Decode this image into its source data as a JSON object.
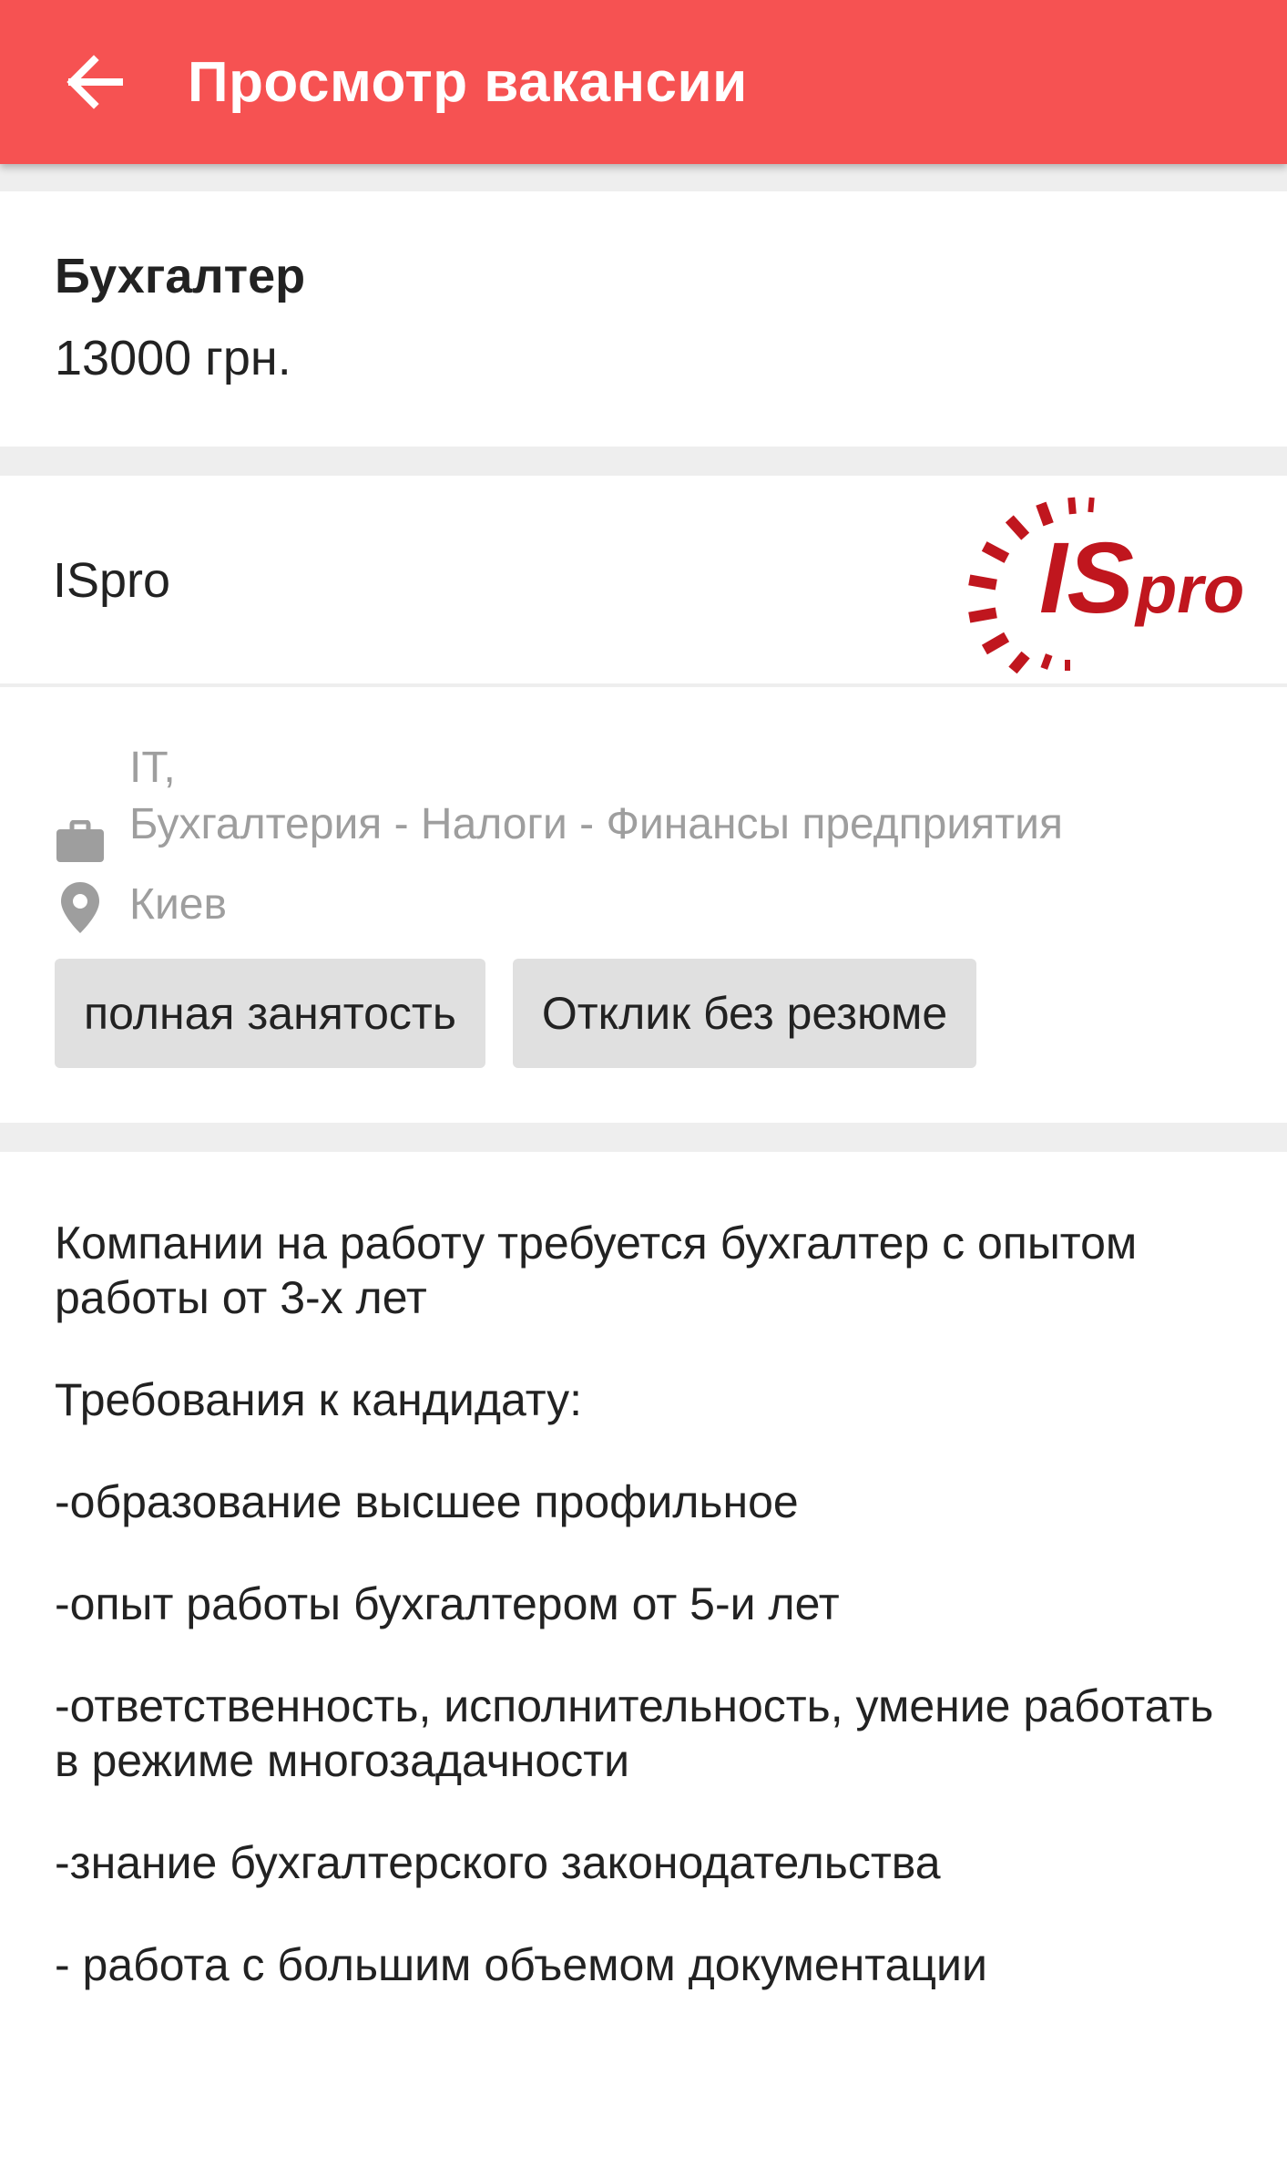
{
  "app_bar": {
    "title": "Просмотр вакансии",
    "back_icon": "arrow-left-icon",
    "color": "#f65252"
  },
  "vacancy": {
    "title": "Бухгалтер",
    "salary": "13000 грн."
  },
  "company": {
    "name": "ISpro",
    "logo_text": "ISpro",
    "logo_color": "#c0161e"
  },
  "info": {
    "category_icon": "briefcase-icon",
    "category_line1": "IT,",
    "category_line2": "Бухгалтерия - Налоги - Финансы предприятия",
    "city_icon": "location-pin-icon",
    "city": "Киев"
  },
  "chips": [
    {
      "label": "полная занятость"
    },
    {
      "label": "Отклик без резюме"
    }
  ],
  "description": {
    "paragraphs": [
      "Компании на работу требуется бухгалтер с опытом работы от 3-х лет",
      "Требования к кандидату:",
      "-образование высшее профильное",
      "-опыт работы бухгалтером от 5-и лет",
      "-ответственность, исполнительность, умение работать в режиме многозадачности",
      "-знание бухгалтерского законодательства",
      "- работа с большим объемом документации"
    ]
  }
}
